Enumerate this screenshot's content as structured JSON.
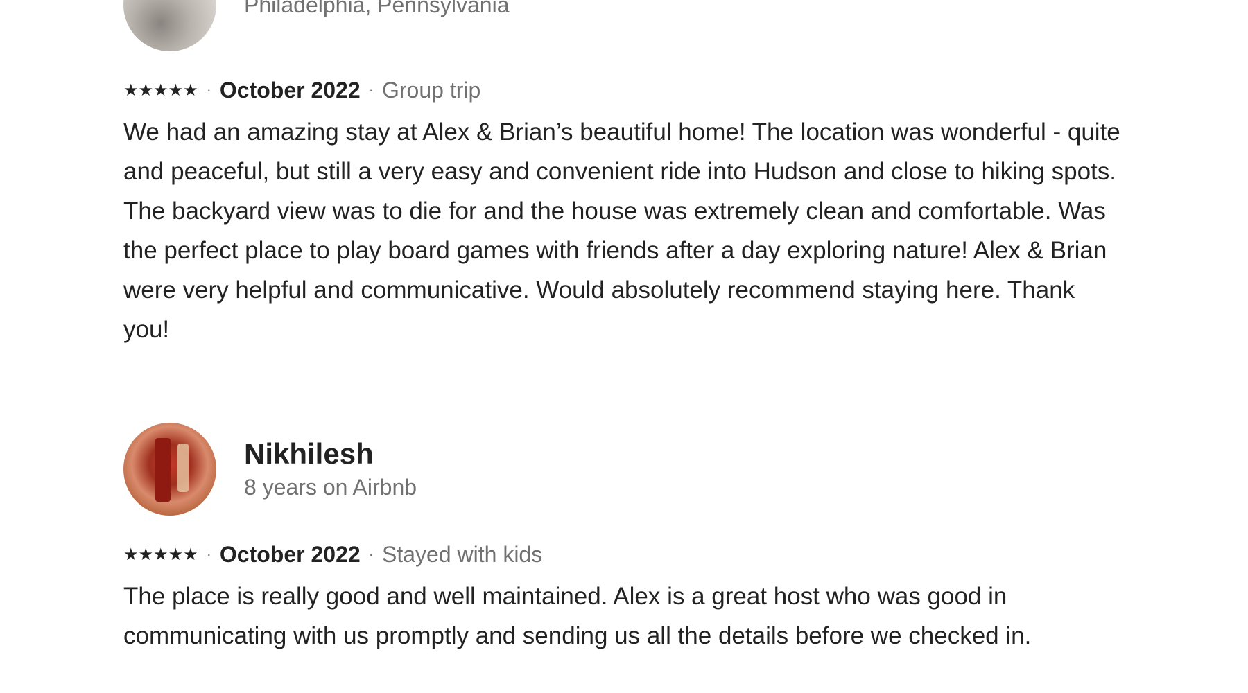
{
  "reviews": [
    {
      "name": "",
      "subtitle": "Philadelphia, Pennsylvania",
      "rating_stars": 5,
      "stars": "★★★★★",
      "date": "October 2022",
      "trip_type": "Group trip",
      "text": "We had an amazing stay at Alex & Brian’s beautiful home! The location was wonderful - quite and peaceful, but still a very easy and convenient ride into Hudson and close to hiking spots. The backyard view was to die for and the house was extremely clean and comfortable. Was the perfect place to play board games with friends after a day exploring nature! Alex & Brian were very helpful and communicative. Would absolutely recommend staying here. Thank you!"
    },
    {
      "name": "Nikhilesh",
      "subtitle": "8 years on Airbnb",
      "rating_stars": 5,
      "stars": "★★★★★",
      "date": "October 2022",
      "trip_type": "Stayed with kids",
      "text": "The place is really good and well maintained. Alex is a great host who was good in communicating with us promptly and sending us all the details before we checked in."
    }
  ],
  "separator": "·",
  "colors": {
    "primary_text": "#222222",
    "secondary_text": "#717171",
    "background": "#ffffff"
  }
}
